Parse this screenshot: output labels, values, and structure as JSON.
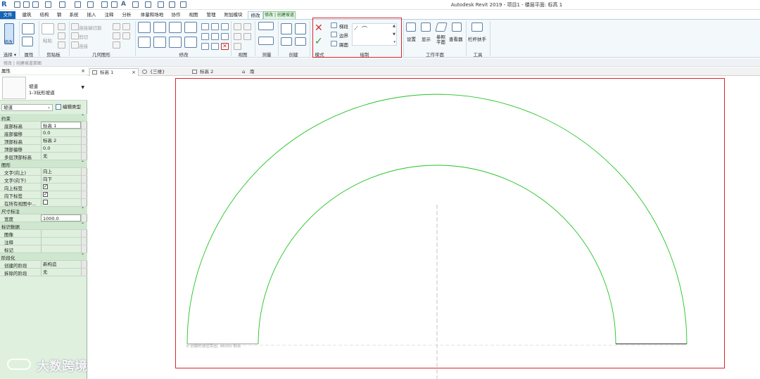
{
  "app": {
    "title": "Autodesk Revit 2019 - 项目1 - 楼层平面: 标高 1",
    "logo": "R"
  },
  "ribbon_tabs": [
    "文件",
    "建筑",
    "结构",
    "钢",
    "系统",
    "插入",
    "注释",
    "分析",
    "体量和场地",
    "协作",
    "视图",
    "管理",
    "附加模块",
    "修改",
    "修改 | 创建坡道草图"
  ],
  "ribbon": {
    "select": {
      "modify_label": "修改",
      "panel": "选择 ▾"
    },
    "properties_panel": "属性",
    "clipboard": {
      "paste": "粘贴",
      "panel": "剪贴板"
    },
    "geometry": {
      "cope": "连接端切割",
      "cut": "剪切",
      "join": "连接",
      "panel": "几何图形"
    },
    "modify_panel": "修改",
    "view_panel": "视图",
    "measure_panel": "测量",
    "create_panel": "创建",
    "mode": {
      "panel": "模式",
      "finish_icon": "check-icon",
      "cancel_icon": "x-icon"
    },
    "draw": {
      "run": "梯段",
      "boundary": "边界",
      "riser": "踢面",
      "panel": "绘制"
    },
    "work_plane": {
      "set": "设置",
      "show": "显示",
      "ref_plane": "参照\n平面",
      "viewer": "查看器",
      "panel": "工作平面"
    },
    "tools": {
      "railing": "栏杆扶手",
      "panel": "工具"
    }
  },
  "options_bar": {
    "text": "修改 | 创建坡道草图"
  },
  "properties": {
    "header": "属性",
    "close": "×",
    "type_name": "坡道",
    "type_sub": "1-3玩形坡道",
    "filter_value": "坡道",
    "edit_type": "编辑类型",
    "rows": [
      {
        "group": true,
        "k": "约束"
      },
      {
        "k": "底部标高",
        "v": "标高 1",
        "boxed": true
      },
      {
        "k": "底部偏移",
        "v": "0.0"
      },
      {
        "k": "顶部标高",
        "v": "标高 2"
      },
      {
        "k": "顶部偏移",
        "v": "0.0"
      },
      {
        "k": "多层顶部标高",
        "v": "无"
      },
      {
        "group": true,
        "k": "图形"
      },
      {
        "k": "文字(向上)",
        "v": "向上"
      },
      {
        "k": "文字(向下)",
        "v": "向下"
      },
      {
        "k": "向上标签",
        "check": true
      },
      {
        "k": "向下标签",
        "check": true
      },
      {
        "k": "在所有视图中...",
        "check": false
      },
      {
        "group": true,
        "k": "尺寸标注"
      },
      {
        "k": "宽度",
        "v": "1000.0",
        "boxed": true
      },
      {
        "group": true,
        "k": "标识数据"
      },
      {
        "k": "图像",
        "v": ""
      },
      {
        "k": "注释",
        "v": ""
      },
      {
        "k": "标记",
        "v": ""
      },
      {
        "group": true,
        "k": "阶段化"
      },
      {
        "k": "创建的阶段",
        "v": "新构造"
      },
      {
        "k": "拆除的阶段",
        "v": "无"
      }
    ]
  },
  "view_tabs": [
    {
      "label": "标高 1",
      "active": true,
      "close": "×"
    },
    {
      "label": "{三维}",
      "active": false
    },
    {
      "label": "标高 2",
      "active": false
    },
    {
      "label": "南",
      "active": false
    }
  ],
  "canvas": {
    "sketch_note": "0 创建的坡道草图, 48000 剩余",
    "watermark": "大数跨境",
    "sketch_color": "#22c322",
    "frame_color": "#d9262c"
  }
}
